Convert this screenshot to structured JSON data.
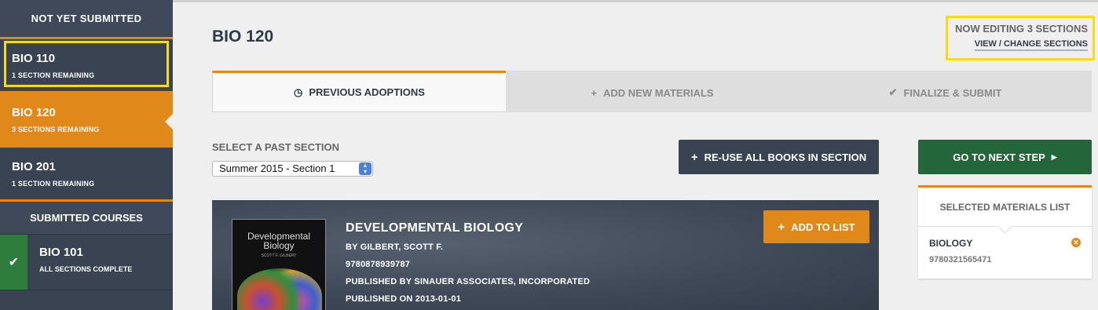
{
  "sidebar": {
    "not_submitted_heading": "NOT YET SUBMITTED",
    "courses": [
      {
        "code": "BIO 110",
        "remaining": "1 SECTION REMAINING"
      },
      {
        "code": "BIO 120",
        "remaining": "3 SECTIONS REMAINING"
      },
      {
        "code": "BIO 201",
        "remaining": "1 SECTION REMAINING"
      }
    ],
    "submitted_heading": "SUBMITTED COURSES",
    "submitted": [
      {
        "code": "BIO 101",
        "status": "ALL SECTIONS COMPLETE",
        "icon": "check-icon"
      }
    ]
  },
  "header": {
    "title": "BIO 120",
    "editing": "NOW EDITING 3 SECTIONS",
    "change_link": "VIEW / CHANGE SECTIONS"
  },
  "tabs": [
    {
      "label": "PREVIOUS ADOPTIONS",
      "icon": "clock-icon"
    },
    {
      "label": "ADD NEW MATERIALS",
      "icon": "plus-icon"
    },
    {
      "label": "FINALIZE & SUBMIT",
      "icon": "check-icon"
    }
  ],
  "past_section": {
    "label": "SELECT A PAST SECTION",
    "selected": "Summer 2015 - Section 1"
  },
  "actions": {
    "reuse": "RE-USE ALL BOOKS IN SECTION",
    "next": "GO TO NEXT STEP"
  },
  "selected_list": {
    "heading": "SELECTED MATERIALS LIST",
    "items": [
      {
        "name": "BIOLOGY",
        "isbn": "9780321565471"
      }
    ]
  },
  "book": {
    "title": "DEVELOPMENTAL BIOLOGY",
    "author": "BY GILBERT, SCOTT F.",
    "isbn": "9780878939787",
    "publisher": "PUBLISHED BY SINAUER ASSOCIATES, INCORPORATED",
    "published": "PUBLISHED ON 2013-01-01",
    "add_label": "ADD TO LIST",
    "cover_title": "Developmental Biology",
    "cover_author": "SCOTT F. GILBERT"
  },
  "colors": {
    "accent": "#e0891a",
    "sidebar": "#394352",
    "green": "#23663a",
    "highlight": "#f5dc14"
  }
}
